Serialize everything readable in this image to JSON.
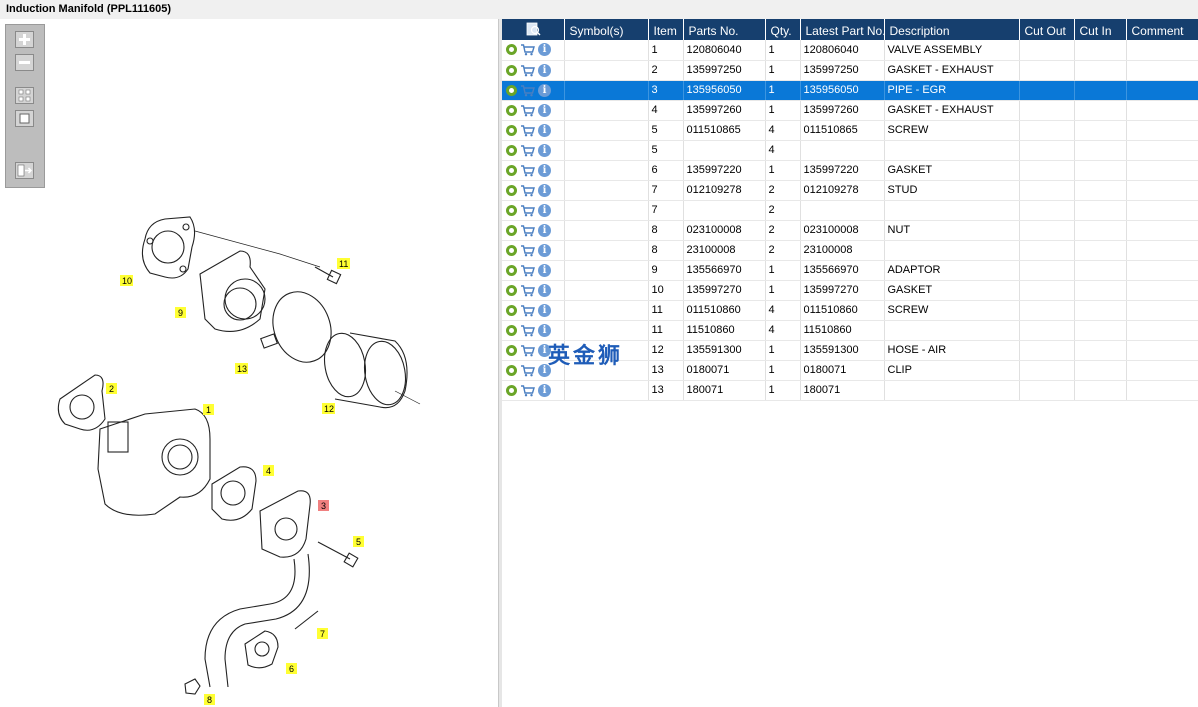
{
  "window": {
    "title": "Induction Manifold (PPL111605)"
  },
  "toolbar": {
    "buttons": [
      "zoom-in",
      "zoom-out",
      "fit-all",
      "fit-window",
      "toggle-panel"
    ]
  },
  "diagram": {
    "callouts": [
      "10",
      "9",
      "11",
      "13",
      "12",
      "2",
      "1",
      "4",
      "3",
      "5",
      "7",
      "6",
      "8"
    ],
    "highlighted_callout": "3"
  },
  "table": {
    "headers": [
      "",
      "Symbol(s)",
      "Item",
      "Parts No.",
      "Qty.",
      "Latest Part No.",
      "Description",
      "Cut Out",
      "Cut In",
      "Comment"
    ],
    "selected_row_index": 2,
    "rows": [
      {
        "symbol": "",
        "item": "1",
        "part": "120806040",
        "qty": "1",
        "latest": "120806040",
        "desc": "VALVE ASSEMBLY",
        "cut_out": "",
        "cut_in": "",
        "comment": ""
      },
      {
        "symbol": "",
        "item": "2",
        "part": "135997250",
        "qty": "1",
        "latest": "135997250",
        "desc": "GASKET - EXHAUST",
        "cut_out": "",
        "cut_in": "",
        "comment": ""
      },
      {
        "symbol": "",
        "item": "3",
        "part": "135956050",
        "qty": "1",
        "latest": "135956050",
        "desc": "PIPE - EGR",
        "cut_out": "",
        "cut_in": "",
        "comment": ""
      },
      {
        "symbol": "",
        "item": "4",
        "part": "135997260",
        "qty": "1",
        "latest": "135997260",
        "desc": "GASKET - EXHAUST",
        "cut_out": "",
        "cut_in": "",
        "comment": ""
      },
      {
        "symbol": "",
        "item": "5",
        "part": "011510865",
        "qty": "4",
        "latest": "011510865",
        "desc": "SCREW",
        "cut_out": "",
        "cut_in": "",
        "comment": ""
      },
      {
        "symbol": "",
        "item": "5",
        "part": "",
        "qty": "4",
        "latest": "",
        "desc": "",
        "cut_out": "",
        "cut_in": "",
        "comment": ""
      },
      {
        "symbol": "",
        "item": "6",
        "part": "135997220",
        "qty": "1",
        "latest": "135997220",
        "desc": "GASKET",
        "cut_out": "",
        "cut_in": "",
        "comment": ""
      },
      {
        "symbol": "",
        "item": "7",
        "part": "012109278",
        "qty": "2",
        "latest": "012109278",
        "desc": "STUD",
        "cut_out": "",
        "cut_in": "",
        "comment": ""
      },
      {
        "symbol": "",
        "item": "7",
        "part": "",
        "qty": "2",
        "latest": "",
        "desc": "",
        "cut_out": "",
        "cut_in": "",
        "comment": ""
      },
      {
        "symbol": "",
        "item": "8",
        "part": "023100008",
        "qty": "2",
        "latest": "023100008",
        "desc": "NUT",
        "cut_out": "",
        "cut_in": "",
        "comment": ""
      },
      {
        "symbol": "",
        "item": "8",
        "part": "23100008",
        "qty": "2",
        "latest": "23100008",
        "desc": "",
        "cut_out": "",
        "cut_in": "",
        "comment": ""
      },
      {
        "symbol": "",
        "item": "9",
        "part": "135566970",
        "qty": "1",
        "latest": "135566970",
        "desc": "ADAPTOR",
        "cut_out": "",
        "cut_in": "",
        "comment": ""
      },
      {
        "symbol": "",
        "item": "10",
        "part": "135997270",
        "qty": "1",
        "latest": "135997270",
        "desc": "GASKET",
        "cut_out": "",
        "cut_in": "",
        "comment": ""
      },
      {
        "symbol": "",
        "item": "11",
        "part": "011510860",
        "qty": "4",
        "latest": "011510860",
        "desc": "SCREW",
        "cut_out": "",
        "cut_in": "",
        "comment": ""
      },
      {
        "symbol": "",
        "item": "11",
        "part": "11510860",
        "qty": "4",
        "latest": "11510860",
        "desc": "",
        "cut_out": "",
        "cut_in": "",
        "comment": ""
      },
      {
        "symbol": "",
        "item": "12",
        "part": "135591300",
        "qty": "1",
        "latest": "135591300",
        "desc": "HOSE - AIR",
        "cut_out": "",
        "cut_in": "",
        "comment": ""
      },
      {
        "symbol": "",
        "item": "13",
        "part": "0180071",
        "qty": "1",
        "latest": "0180071",
        "desc": "CLIP",
        "cut_out": "",
        "cut_in": "",
        "comment": ""
      },
      {
        "symbol": "",
        "item": "13",
        "part": "180071",
        "qty": "1",
        "latest": "180071",
        "desc": "",
        "cut_out": "",
        "cut_in": "",
        "comment": ""
      }
    ]
  },
  "watermark": {
    "text": "英金狮"
  },
  "colors": {
    "header_bg": "#163f6e",
    "selected_row": "#0a78d7",
    "callout_fill": "#ffff33",
    "callout_highlight": "#f08080"
  }
}
